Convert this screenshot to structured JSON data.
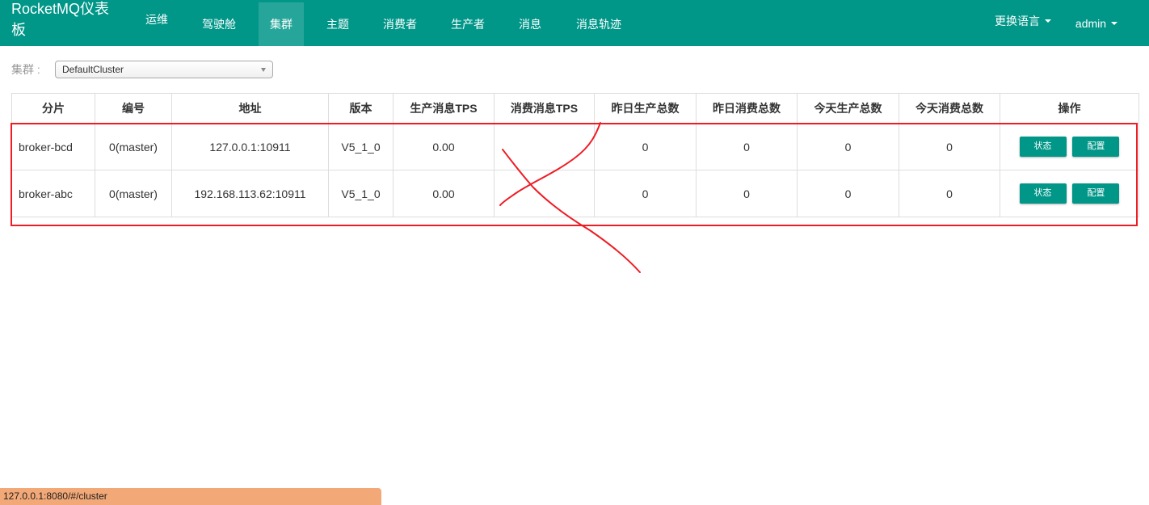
{
  "app": {
    "brand": "RocketMQ仪表板"
  },
  "nav": {
    "items": [
      {
        "label": "运维",
        "name": "nav-ops"
      },
      {
        "label": "驾驶舱",
        "name": "nav-cockpit"
      },
      {
        "label": "集群",
        "name": "nav-cluster",
        "active": true
      },
      {
        "label": "主题",
        "name": "nav-topic"
      },
      {
        "label": "消费者",
        "name": "nav-consumer"
      },
      {
        "label": "生产者",
        "name": "nav-producer"
      },
      {
        "label": "消息",
        "name": "nav-message"
      },
      {
        "label": "消息轨迹",
        "name": "nav-message-trace"
      }
    ],
    "language": "更换语言",
    "user": "admin"
  },
  "filter": {
    "label": "集群 :",
    "selected": "DefaultCluster"
  },
  "table": {
    "headers": [
      "分片",
      "编号",
      "地址",
      "版本",
      "生产消息TPS",
      "消费消息TPS",
      "昨日生产总数",
      "昨日消费总数",
      "今天生产总数",
      "今天消费总数",
      "操作"
    ],
    "rows": [
      {
        "broker": "broker-bcd",
        "id": "0(master)",
        "address": "127.0.0.1:10911",
        "version": "V5_1_0",
        "produce_tps": "0.00",
        "consume_tps": "",
        "yesterday_produce": "0",
        "yesterday_consume": "0",
        "today_produce": "0",
        "today_consume": "0"
      },
      {
        "broker": "broker-abc",
        "id": "0(master)",
        "address": "192.168.113.62:10911",
        "version": "V5_1_0",
        "produce_tps": "0.00",
        "consume_tps": "",
        "yesterday_produce": "0",
        "yesterday_consume": "0",
        "today_produce": "0",
        "today_consume": "0"
      }
    ],
    "actions": {
      "status": "状态",
      "config": "配置"
    }
  },
  "statusbar": {
    "url": "127.0.0.1:8080/#/cluster"
  },
  "colors": {
    "primary": "#009688",
    "active_nav": "#26a69a",
    "annotation": "#ee1c25",
    "statusbar": "#f2a877"
  }
}
